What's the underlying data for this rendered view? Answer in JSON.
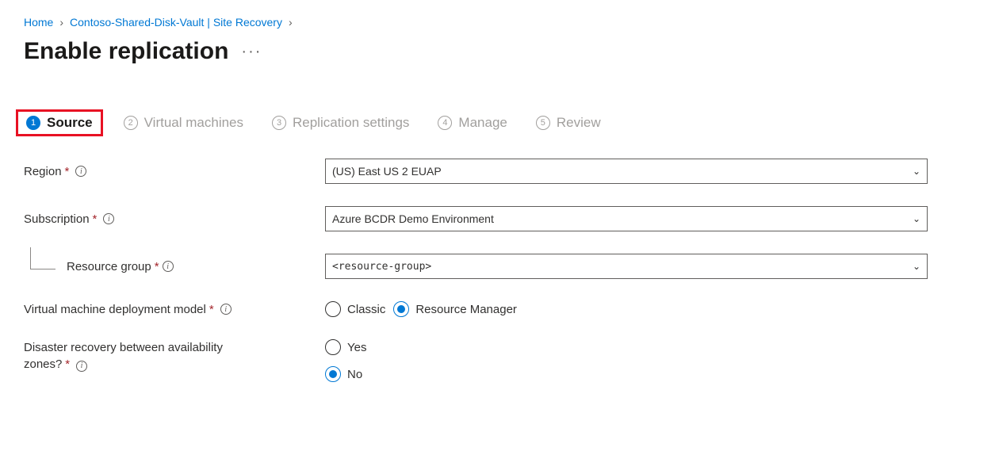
{
  "breadcrumbs": {
    "home": "Home",
    "vault": "Contoso-Shared-Disk-Vault | Site Recovery"
  },
  "page": {
    "title": "Enable replication"
  },
  "steps": [
    {
      "num": "1",
      "label": "Source",
      "active": true
    },
    {
      "num": "2",
      "label": "Virtual machines",
      "active": false
    },
    {
      "num": "3",
      "label": "Replication settings",
      "active": false
    },
    {
      "num": "4",
      "label": "Manage",
      "active": false
    },
    {
      "num": "5",
      "label": "Review",
      "active": false
    }
  ],
  "form": {
    "region": {
      "label": "Region",
      "value": "(US) East US 2 EUAP"
    },
    "subscription": {
      "label": "Subscription",
      "value": "Azure BCDR Demo Environment"
    },
    "resource_group": {
      "label": "Resource group",
      "value": "<resource-group>"
    },
    "deployment_model": {
      "label": "Virtual machine deployment model",
      "options": {
        "classic": "Classic",
        "rm": "Resource Manager"
      },
      "selected": "rm"
    },
    "dr_zones": {
      "label_line1": "Disaster recovery between availability",
      "label_line2": "zones?",
      "options": {
        "yes": "Yes",
        "no": "No"
      },
      "selected": "no"
    }
  }
}
